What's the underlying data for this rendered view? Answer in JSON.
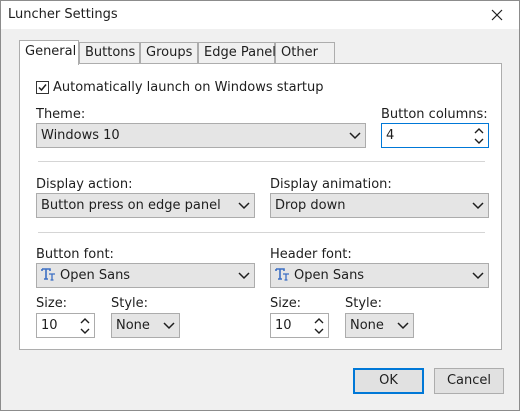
{
  "window": {
    "title": "Luncher Settings"
  },
  "tabs": [
    {
      "label": "General"
    },
    {
      "label": "Buttons"
    },
    {
      "label": "Groups"
    },
    {
      "label": "Edge Panel"
    },
    {
      "label": "Other"
    }
  ],
  "general": {
    "autostart_label": "Automatically launch on Windows startup",
    "autostart_checked": true,
    "theme_label": "Theme:",
    "theme_value": "Windows 10",
    "columns_label": "Button columns:",
    "columns_value": "4",
    "display_action_label": "Display action:",
    "display_action_value": "Button press on edge panel",
    "display_animation_label": "Display animation:",
    "display_animation_value": "Drop down",
    "button_font_label": "Button font:",
    "button_font_value": "Open Sans",
    "header_font_label": "Header font:",
    "header_font_value": "Open Sans",
    "button_size_label": "Size:",
    "button_size_value": "10",
    "button_style_label": "Style:",
    "button_style_value": "None",
    "header_size_label": "Size:",
    "header_size_value": "10",
    "header_style_label": "Style:",
    "header_style_value": "None"
  },
  "footer": {
    "ok_label": "OK",
    "cancel_label": "Cancel"
  },
  "icons": [
    "close-icon",
    "checkmark-icon",
    "chevron-down-icon",
    "spin-arrows-icon",
    "font-icon"
  ],
  "colors": {
    "accent": "#0078d7",
    "font_icon": "#3c6fc4"
  }
}
